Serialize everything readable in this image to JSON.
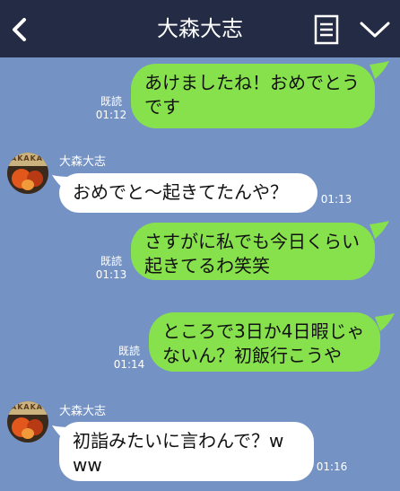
{
  "header": {
    "title": "大森大志",
    "back_icon": "chevron-left-icon",
    "notes_icon": "notes-icon",
    "menu_icon": "chevron-down-icon",
    "background": "#232c44"
  },
  "colors": {
    "chat_background": "#7493c4",
    "outgoing_bubble": "#86e14c",
    "incoming_bubble": "#ffffff"
  },
  "messages": [
    {
      "direction": "outgoing",
      "text": "あけましたね！おめでとう\nです",
      "read": "既読",
      "time": "01:12"
    },
    {
      "direction": "incoming",
      "sender": "大森大志",
      "text": "おめでと〜起きてたんや？",
      "time": "01:13"
    },
    {
      "direction": "outgoing",
      "text": "さすがに私でも今日くらい\n起きてるわ笑笑",
      "read": "既読",
      "time": "01:13"
    },
    {
      "direction": "outgoing",
      "text": "ところで3日か4日暇じゃ\nないん？初飯行こうや",
      "read": "既読",
      "time": "01:14"
    },
    {
      "direction": "incoming",
      "sender": "大森大志",
      "text": "初詣みたいに言わんで？w\nww",
      "time": "01:16"
    }
  ]
}
